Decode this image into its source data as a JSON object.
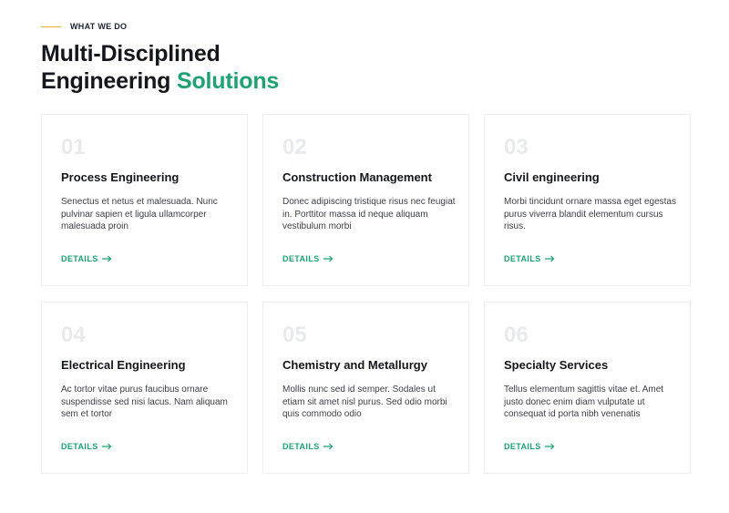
{
  "section": {
    "eyebrow": "WHAT WE DO",
    "heading_line1": "Multi-Disciplined",
    "heading_line2": "Engineering",
    "heading_accent": "Solutions"
  },
  "colors": {
    "accent": "#1fa172",
    "eyebrow_line": "#f2b134",
    "number": "#e8eaed",
    "heading": "#14171c"
  },
  "cards": [
    {
      "number": "01",
      "title": "Process Engineering",
      "description": "Senectus et netus et malesuada. Nunc pulvinar sapien et ligula ullamcorper malesuada proin",
      "link_label": "DETAILS",
      "link_icon": "arrow-right-icon"
    },
    {
      "number": "02",
      "title": "Construction Management",
      "description": "Donec adipiscing tristique risus nec feugiat in. Porttitor massa id neque aliquam vestibulum morbi",
      "link_label": "DETAILS",
      "link_icon": "arrow-right-icon"
    },
    {
      "number": "03",
      "title": "Civil engineering",
      "description": "Morbi tincidunt ornare massa eget egestas purus viverra blandit elementum cursus risus.",
      "link_label": "DETAILS",
      "link_icon": "arrow-right-icon"
    },
    {
      "number": "04",
      "title": "Electrical Engineering",
      "description": "Ac tortor vitae purus faucibus ornare suspendisse sed nisi lacus. Nam aliquam sem et tortor",
      "link_label": "DETAILS",
      "link_icon": "arrow-right-icon"
    },
    {
      "number": "05",
      "title": "Chemistry and Metallurgy",
      "description": "Mollis nunc sed id semper. Sodales ut etiam sit amet nisl purus. Sed odio morbi quis commodo odio",
      "link_label": "DETAILS",
      "link_icon": "arrow-right-icon"
    },
    {
      "number": "06",
      "title": "Specialty Services",
      "description": "Tellus elementum sagittis vitae et. Amet justo donec enim diam vulputate ut consequat id porta nibh venenatis",
      "link_label": "DETAILS",
      "link_icon": "arrow-right-icon"
    }
  ]
}
